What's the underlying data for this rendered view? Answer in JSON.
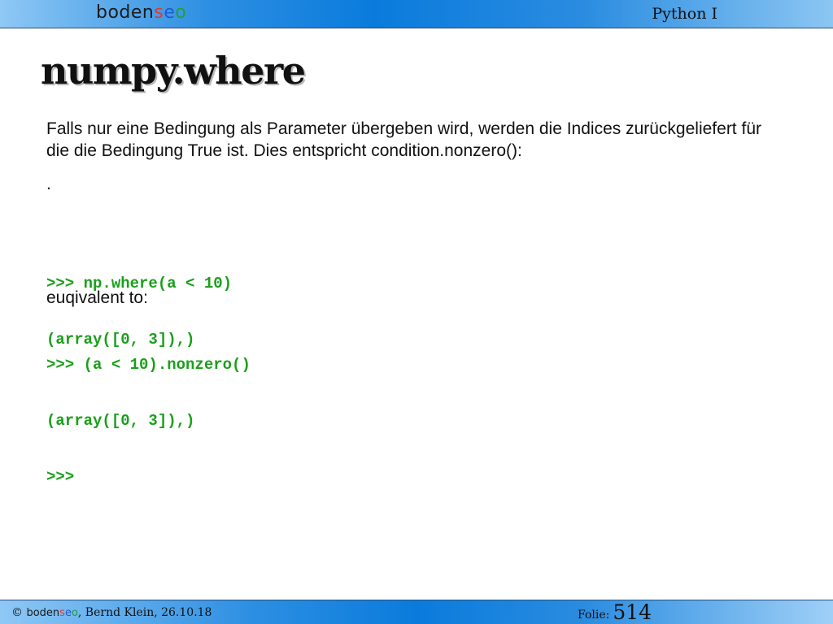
{
  "header": {
    "logo": {
      "part1": "boden",
      "part2": "s",
      "part3": "e",
      "part4": "o"
    },
    "course_title": "Python I"
  },
  "slide": {
    "title": "numpy.where",
    "paragraph1": "Falls nur eine Bedingung als Parameter übergeben wird, werden die Indices zurückgeliefert für die die Bedingung True ist. Dies entspricht condition.nonzero():",
    "dot": ".",
    "code1": [
      ">>> np.where(a < 10)",
      "(array([0, 3]),)"
    ],
    "paragraph2": "euqivalent to:",
    "code2": [
      ">>> (a < 10).nonzero()",
      "(array([0, 3]),)",
      ">>>"
    ]
  },
  "footer": {
    "copyright_symbol": "©",
    "logo": {
      "part1": "boden",
      "part2": "s",
      "part3": "e",
      "part4": "o"
    },
    "author_date": ", Bernd Klein, 26.10.18",
    "folie_label": "Folie:",
    "folie_number": "514"
  }
}
